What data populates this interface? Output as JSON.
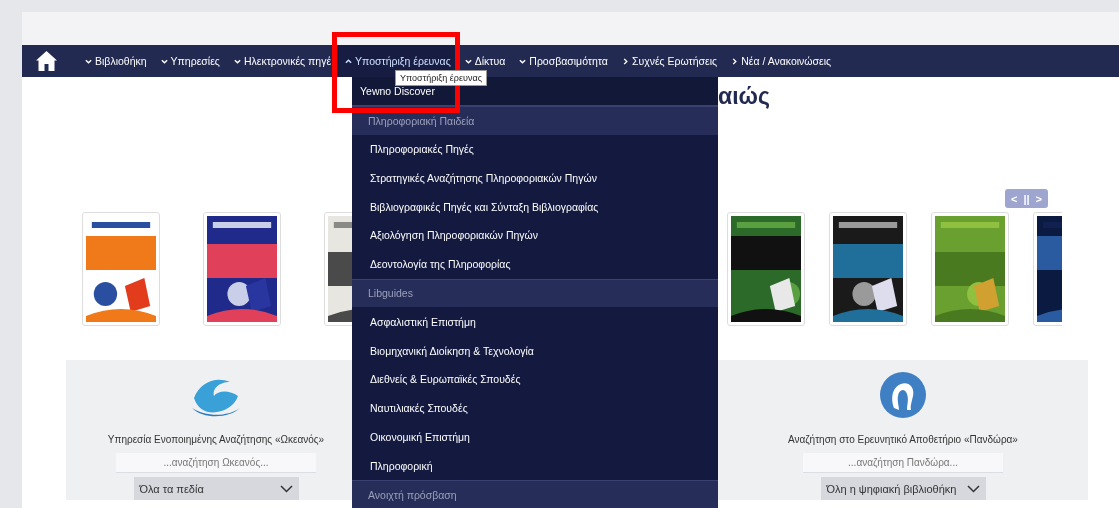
{
  "nav": {
    "items": [
      {
        "kind": "menu",
        "label": "Βιβλιοθήκη",
        "expanded": false,
        "selected": false
      },
      {
        "kind": "menu",
        "label": "Υπηρεσίες",
        "expanded": false,
        "selected": false
      },
      {
        "kind": "menu",
        "label": "Ηλεκτρονικές πηγέ",
        "expanded": false,
        "selected": false
      },
      {
        "kind": "menu",
        "label": "Υποστήριξη έρευνας",
        "expanded": true,
        "selected": true
      },
      {
        "kind": "menu",
        "label": "Δίκτυα",
        "expanded": false,
        "selected": false
      },
      {
        "kind": "menu",
        "label": "Προσβασιμότητα",
        "expanded": false,
        "selected": false
      },
      {
        "kind": "link",
        "label": "Συχνές Ερωτήσεις",
        "selected": false
      },
      {
        "kind": "link",
        "label": "Νέα / Ανακοινώσεις",
        "selected": false
      }
    ]
  },
  "tooltip": "Υποστήριξη έρευνας",
  "dropdown": {
    "items": [
      {
        "kind": "top",
        "label": "Yewno Discover"
      },
      {
        "kind": "header",
        "label": "Πληροφοριακή Παιδεία"
      },
      {
        "kind": "link",
        "label": "Πληροφοριακές Πηγές"
      },
      {
        "kind": "link",
        "label": "Στρατηγικές Αναζήτησης Πληροφοριακών Πηγών"
      },
      {
        "kind": "link",
        "label": "Βιβλιογραφικές Πηγές και Σύνταξη Βιβλιογραφίας"
      },
      {
        "kind": "link",
        "label": "Αξιολόγηση Πληροφοριακών Πηγών"
      },
      {
        "kind": "link",
        "label": "Δεοντολογία της Πληροφορίας"
      },
      {
        "kind": "header",
        "label": "Libguides"
      },
      {
        "kind": "link",
        "label": "Ασφαλιστική Επιστήμη"
      },
      {
        "kind": "link",
        "label": "Βιομηχανική Διοίκηση & Τεχνολογία"
      },
      {
        "kind": "link",
        "label": "Διεθνείς & Ευρωπαϊκές Σπουδές"
      },
      {
        "kind": "link",
        "label": "Ναυτιλιακές Σπουδές"
      },
      {
        "kind": "link",
        "label": "Οικονομική Επιστήμη"
      },
      {
        "kind": "link",
        "label": "Πληροφορική"
      },
      {
        "kind": "header",
        "label": "Ανοιχτή πρόσβαση"
      }
    ]
  },
  "heading": "αιώς",
  "carousel": {
    "controls": [
      "<",
      "||",
      ">"
    ]
  },
  "panels": [
    {
      "title": "Υπηρεσία Ενοποιημένης Αναζήτησης «Ωκεανός»",
      "placeholder": "...αναζήτηση Ωκεανός...",
      "select": "Όλα τα πεδία"
    },
    {
      "title": "Αναζήτηση στο Ερευνητικό Αποθετήριο «Πανδώρα»",
      "placeholder": "...αναζήτηση Πανδώρα...",
      "select": "Όλη η ψηφιακή βιβλιοθήκη"
    }
  ]
}
